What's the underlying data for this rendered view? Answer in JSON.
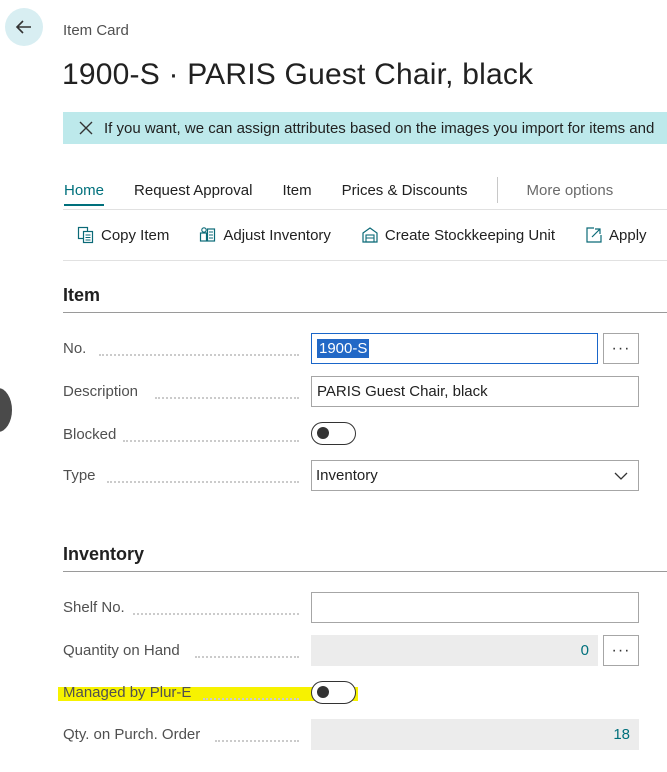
{
  "header": {
    "breadcrumb": "Item Card",
    "title": "1900-S · PARIS Guest Chair, black"
  },
  "banner": {
    "text": "If you want, we can assign attributes based on the images you import for items and"
  },
  "action_tabs": [
    {
      "label": "Home",
      "active": true
    },
    {
      "label": "Request Approval",
      "active": false
    },
    {
      "label": "Item",
      "active": false
    },
    {
      "label": "Prices & Discounts",
      "active": false
    }
  ],
  "more_options": "More options",
  "commands": [
    {
      "label": "Copy Item",
      "icon": "copy-icon"
    },
    {
      "label": "Adjust Inventory",
      "icon": "adjust-inventory-icon"
    },
    {
      "label": "Create Stockkeeping Unit",
      "icon": "stockkeeping-icon"
    },
    {
      "label": "Apply",
      "icon": "apply-template-icon"
    }
  ],
  "item_section": {
    "title": "Item",
    "no_label": "No.",
    "no_value": "1900-S",
    "description_label": "Description",
    "description_value": "PARIS Guest Chair, black",
    "blocked_label": "Blocked",
    "blocked_value": false,
    "type_label": "Type",
    "type_value": "Inventory"
  },
  "inventory_section": {
    "title": "Inventory",
    "shelf_label": "Shelf No.",
    "shelf_value": "",
    "qty_on_hand_label": "Quantity on Hand",
    "qty_on_hand_value": "0",
    "managed_label": "Managed by Plur-E",
    "managed_value": false,
    "qty_purch_label": "Qty. on Purch. Order",
    "qty_purch_value": "18"
  },
  "colors": {
    "accent": "#00707c",
    "banner_bg": "#bde9eb",
    "highlight": "#f7f200",
    "selection": "#2268c6"
  }
}
